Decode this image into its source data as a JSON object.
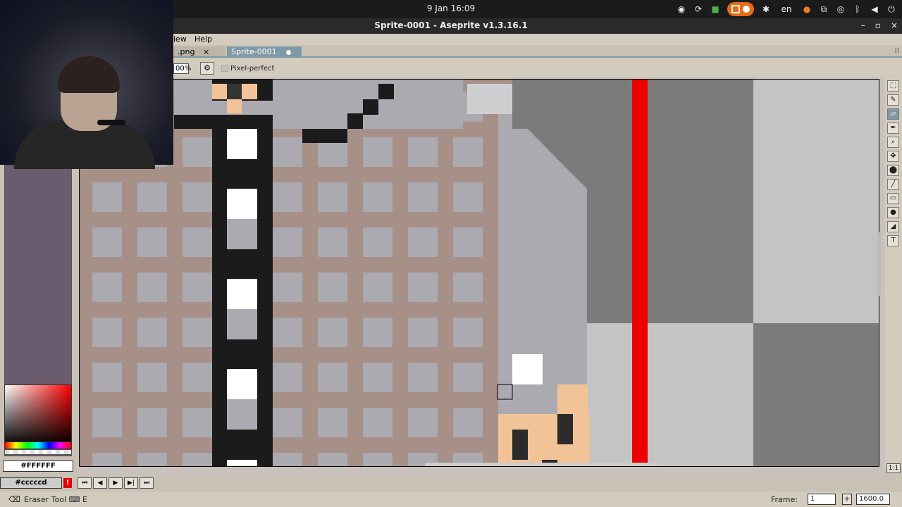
{
  "system_bar": {
    "clock": "9 Jan  16:09",
    "language": "en",
    "tray_icons": [
      "screenshot-icon",
      "refresh-icon",
      "lock-icon",
      "screencast-icon",
      "accessibility-icon",
      "microphone-icon",
      "network-icon",
      "location-icon",
      "bluetooth-icon",
      "volume-icon",
      "power-icon"
    ]
  },
  "window": {
    "title": "Sprite-0001 - Aseprite v1.3.16.1",
    "controls": [
      "–",
      "▫",
      "×"
    ]
  },
  "menu": {
    "items": [
      "iew",
      "Help"
    ]
  },
  "tabs": [
    {
      "label": ".png",
      "active": false,
      "close": "×"
    },
    {
      "label": "Sprite-0001",
      "active": true,
      "modified": true
    }
  ],
  "context_bar": {
    "zoom_value": "00%",
    "pixel_perfect_label": "Pixel-perfect",
    "pixel_perfect_checked": false
  },
  "colors": {
    "foreground_hex": "#FFFFFF",
    "background_hex": "#cccccd",
    "accent": "#7f9aa6",
    "canvas_grid": "#a69088",
    "red_stripe": "#ee0000"
  },
  "timeline": {
    "buttons": [
      "⏮",
      "◀",
      "▶",
      "▶|",
      "⏭"
    ],
    "warning": "!"
  },
  "status": {
    "tool_text": "Eraser Tool",
    "shortcut_icon": "⌨",
    "shortcut_key": "E",
    "frame_label": "Frame:",
    "frame_value": "1",
    "add_label": "+",
    "zoom_value": "1600.0"
  },
  "toolbar": {
    "tools": [
      "marquee-icon",
      "pencil-icon",
      "eraser-icon",
      "eyedropper-icon",
      "zoom-icon",
      "move-icon",
      "fill-icon",
      "line-icon",
      "rectangle-icon",
      "blur-icon",
      "spray-icon",
      "text-icon"
    ],
    "glyphs": [
      "⬚",
      "✎",
      "▱",
      "✒",
      "🔍",
      "✥",
      "⬤",
      "╱",
      "▭",
      "●",
      "◢",
      "T"
    ],
    "selected_index": 2,
    "one_to_one": "1:1",
    "expand": "⤢"
  }
}
